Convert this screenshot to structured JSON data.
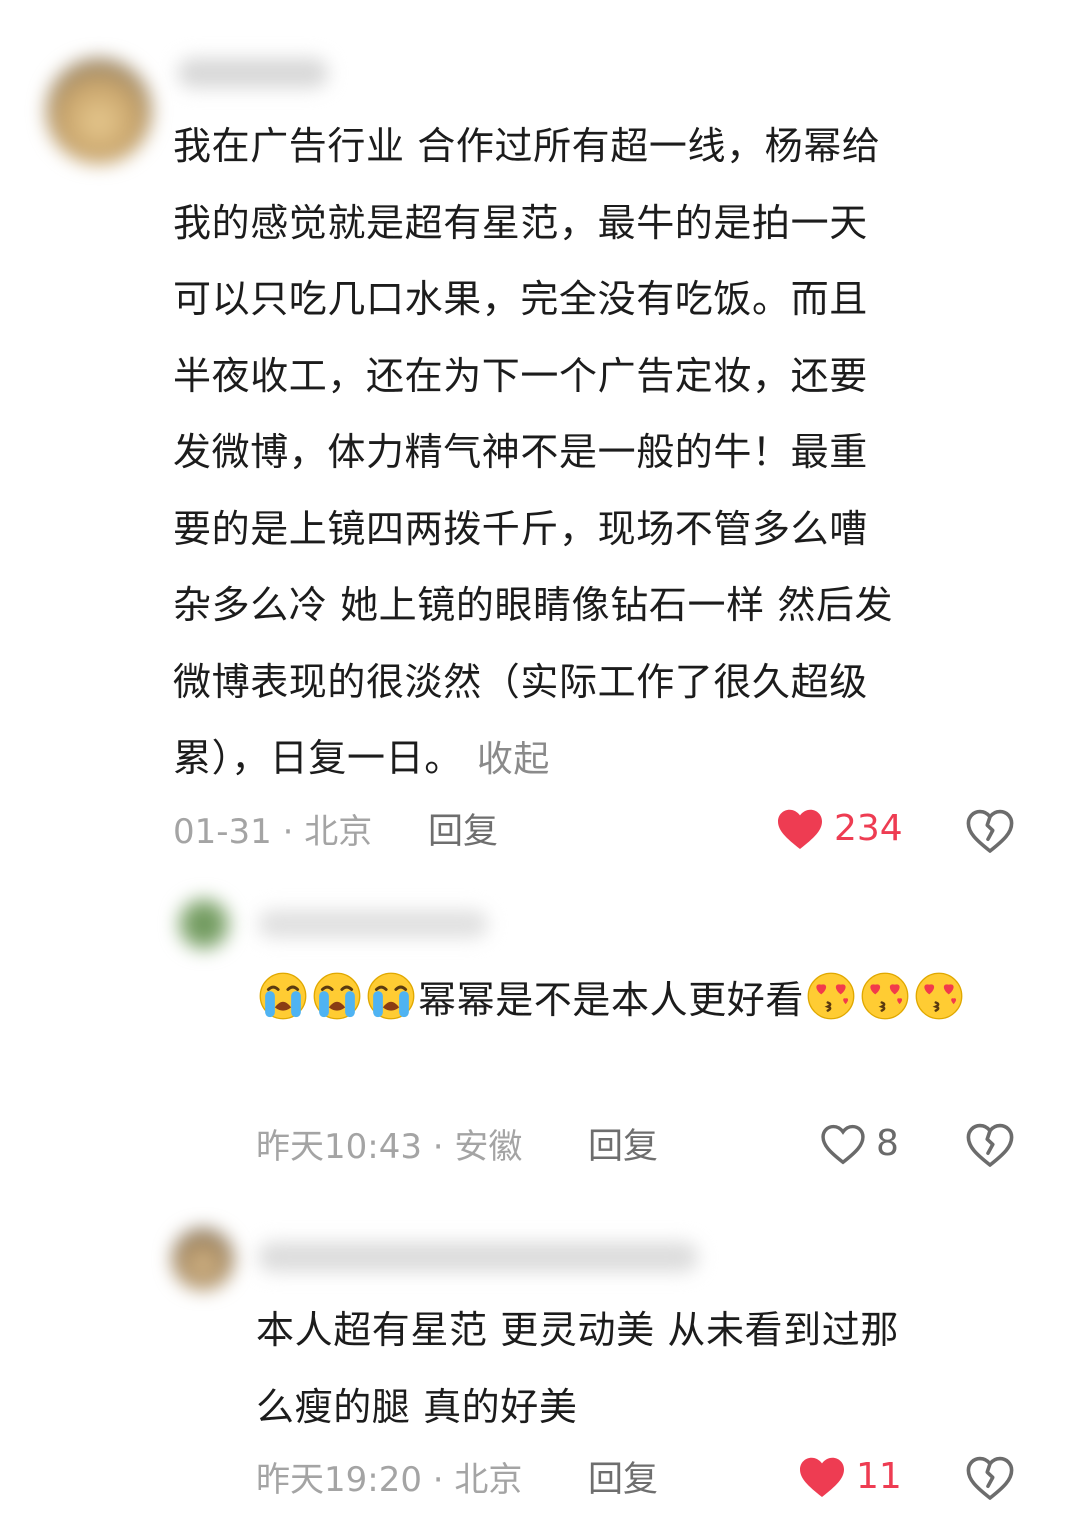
{
  "colors": {
    "like_active": "#ee3c52",
    "meta_text": "#a4a4a4",
    "reply_text": "#6e6e6e",
    "body_text": "#1c1c1c"
  },
  "comments": [
    {
      "author": "",
      "text": "我在广告行业 合作过所有超一线，杨幂给\n我的感觉就是超有星范，最牛的是拍一天\n可以只吃几口水果，完全没有吃饭。而且\n半夜收工，还在为下一个广告定妆，还要\n发微博，体力精气神不是一般的牛！最重\n要的是上镜四两拨千斤，现场不管多么嘈\n杂多么冷 她上镜的眼睛像钻石一样 然后发\n微博表现的很淡然（实际工作了很久超级\n累），日复一日。",
      "collapse_label": "收起",
      "meta": "01-31 · 北京",
      "reply_label": "回复",
      "likes": "234",
      "liked": true,
      "like_icon": "heart-filled-icon",
      "dislike_icon": "broken-heart-icon"
    },
    {
      "author": "",
      "text_before": "",
      "leading_emoji": [
        "loudly-crying-face-emoji",
        "loudly-crying-face-emoji",
        "loudly-crying-face-emoji"
      ],
      "text": "幂幂是不是本人更好看",
      "trailing_emoji": [
        "face-blowing-kiss-hearts-emoji",
        "face-blowing-kiss-hearts-emoji",
        "face-blowing-kiss-hearts-emoji"
      ],
      "meta": "昨天10:43 · 安徽",
      "reply_label": "回复",
      "likes": "8",
      "liked": false,
      "like_icon": "heart-outline-icon",
      "dislike_icon": "broken-heart-icon"
    },
    {
      "author": "",
      "text": "本人超有星范 更灵动美 从未看到过那\n么瘦的腿 真的好美",
      "meta": "昨天19:20 · 北京",
      "reply_label": "回复",
      "likes": "11",
      "liked": true,
      "like_icon": "heart-filled-icon",
      "dislike_icon": "broken-heart-icon"
    }
  ]
}
